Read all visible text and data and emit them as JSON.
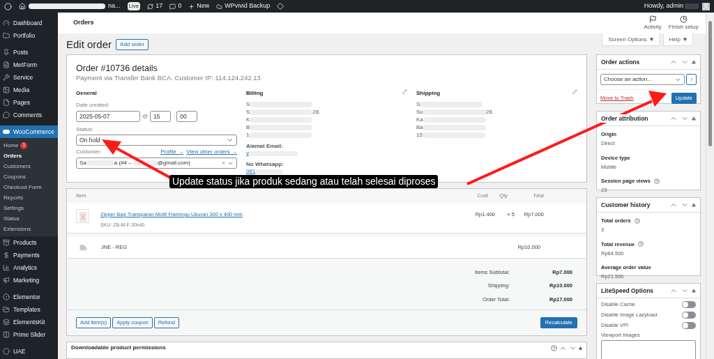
{
  "admin_bar": {
    "site_name": "na...",
    "live_badge": "Live",
    "updates": "17",
    "comments": "0",
    "new": "New",
    "backup": "WPvivid Backup",
    "greeting": "Howdy, admin"
  },
  "sidebar": {
    "items": [
      {
        "label": "Dashboard",
        "selected": false
      },
      {
        "label": "Portfolio",
        "selected": false
      },
      {
        "label": "Posts",
        "selected": false
      },
      {
        "label": "MetForm",
        "selected": false
      },
      {
        "label": "Service",
        "selected": false
      },
      {
        "label": "Media",
        "selected": false
      },
      {
        "label": "Pages",
        "selected": false
      },
      {
        "label": "Comments",
        "selected": false
      },
      {
        "label": "WooCommerce",
        "selected": true,
        "children": [
          {
            "label": "Home",
            "badge": "1",
            "selected": false
          },
          {
            "label": "Orders",
            "selected": true
          },
          {
            "label": "Customers",
            "selected": false
          },
          {
            "label": "Coupons",
            "selected": false
          },
          {
            "label": "Checkout Form",
            "selected": false
          },
          {
            "label": "Reports",
            "selected": false
          },
          {
            "label": "Settings",
            "selected": false
          },
          {
            "label": "Status",
            "selected": false
          },
          {
            "label": "Extensions",
            "selected": false
          }
        ]
      },
      {
        "label": "Products",
        "selected": false
      },
      {
        "label": "Payments",
        "selected": false
      },
      {
        "label": "Analytics",
        "selected": false
      },
      {
        "label": "Marketing",
        "selected": false
      },
      {
        "label": "Elementor",
        "selected": false
      },
      {
        "label": "Templates",
        "selected": false
      },
      {
        "label": "ElementsKit",
        "selected": false
      },
      {
        "label": "Prime Slider",
        "selected": false
      },
      {
        "label": "UAE",
        "selected": false
      }
    ]
  },
  "header": {
    "title": "Orders",
    "actions": [
      "Activity",
      "Finish setup"
    ]
  },
  "screen_tabs": [
    "Screen Options",
    "Help"
  ],
  "page": {
    "title": "Edit order",
    "add_button": "Add order"
  },
  "order": {
    "title": "Order #10736 details",
    "subtitle": "Payment via Transfer Bank BCA. Customer IP: 114.124.242.13",
    "general": {
      "heading": "General",
      "date_label": "Date created:",
      "date": "2025-05-07",
      "at": "@",
      "hour": "15",
      "colon": ":",
      "minute": "00",
      "status_label": "Status:",
      "status": "On hold",
      "customer_label": "Customer:",
      "profile_link": "Profile →",
      "orders_link": "View other orders →",
      "customer_parts": [
        "Sa",
        "a (#4 –",
        "@gmail.com)"
      ],
      "clear": "×"
    },
    "billing": {
      "heading": "Billing",
      "lines": [
        {
          "start": "S"
        },
        {
          "start": "S",
          "end": "28."
        },
        {
          "start": "K"
        },
        {
          "start": "B"
        },
        {
          "start": "1"
        }
      ],
      "email_label": "Alamat Email:",
      "email": "v",
      "whatsapp_label": "No Whatsapp:",
      "whatsapp": "081"
    },
    "shipping": {
      "heading": "Shipping",
      "lines": [
        {
          "start": "S"
        },
        {
          "start": "Su",
          "end": "28."
        },
        {
          "start": "Ka"
        },
        {
          "start": "Ba"
        },
        {
          "start": "15"
        }
      ]
    }
  },
  "items": {
    "columns": [
      "Item",
      "Cost",
      "Qty",
      "Total"
    ],
    "products": [
      {
        "name": "Zipper Bag Transparan Motif Flamingo Ukuran 300 x 400 mm",
        "sku": "SKU: ZB-M-F-30x40",
        "cost": "Rp1.400",
        "qty": "× 5",
        "total": "Rp7.000"
      }
    ],
    "shipping": [
      {
        "name": "JNE - REG",
        "total": "Rp10.000"
      }
    ],
    "totals": [
      {
        "label": "Items Subtotal:",
        "value": "Rp7.000"
      },
      {
        "label": "Shipping:",
        "value": "Rp10.000"
      },
      {
        "label": "Order Total:",
        "value": "Rp17.000"
      }
    ],
    "buttons": [
      "Add item(s)",
      "Apply coupon",
      "Refund"
    ],
    "recalculate": "Recalculate"
  },
  "downloads": {
    "title": "Downloadable product permissions"
  },
  "order_actions": {
    "title": "Order actions",
    "select": "Choose an action...",
    "trash": "Move to Trash",
    "update": "Update"
  },
  "attribution": {
    "title": "Order attribution",
    "fields": [
      {
        "label": "Origin",
        "value": "Direct",
        "help": false
      },
      {
        "label": "Device type",
        "value": "Mobile",
        "help": false
      },
      {
        "label": "Session page views",
        "value": "23",
        "help": true
      }
    ]
  },
  "history": {
    "title": "Customer history",
    "fields": [
      {
        "label": "Total orders",
        "value": "3",
        "help": true
      },
      {
        "label": "Total revenue",
        "value": "Rp64.500",
        "help": true
      },
      {
        "label": "Average order value",
        "value": "Rp21.500",
        "help": false
      }
    ]
  },
  "litespeed": {
    "title": "LiteSpeed Options",
    "toggles": [
      {
        "label": "Disable Cache",
        "on": false
      },
      {
        "label": "Disable Image Lazyload",
        "on": false
      },
      {
        "label": "Disable VPI",
        "on": false
      }
    ],
    "viewport_label": "Viewport Images"
  },
  "annotation": {
    "caption": "Update status jika produk sedang atau telah selesai diproses"
  }
}
